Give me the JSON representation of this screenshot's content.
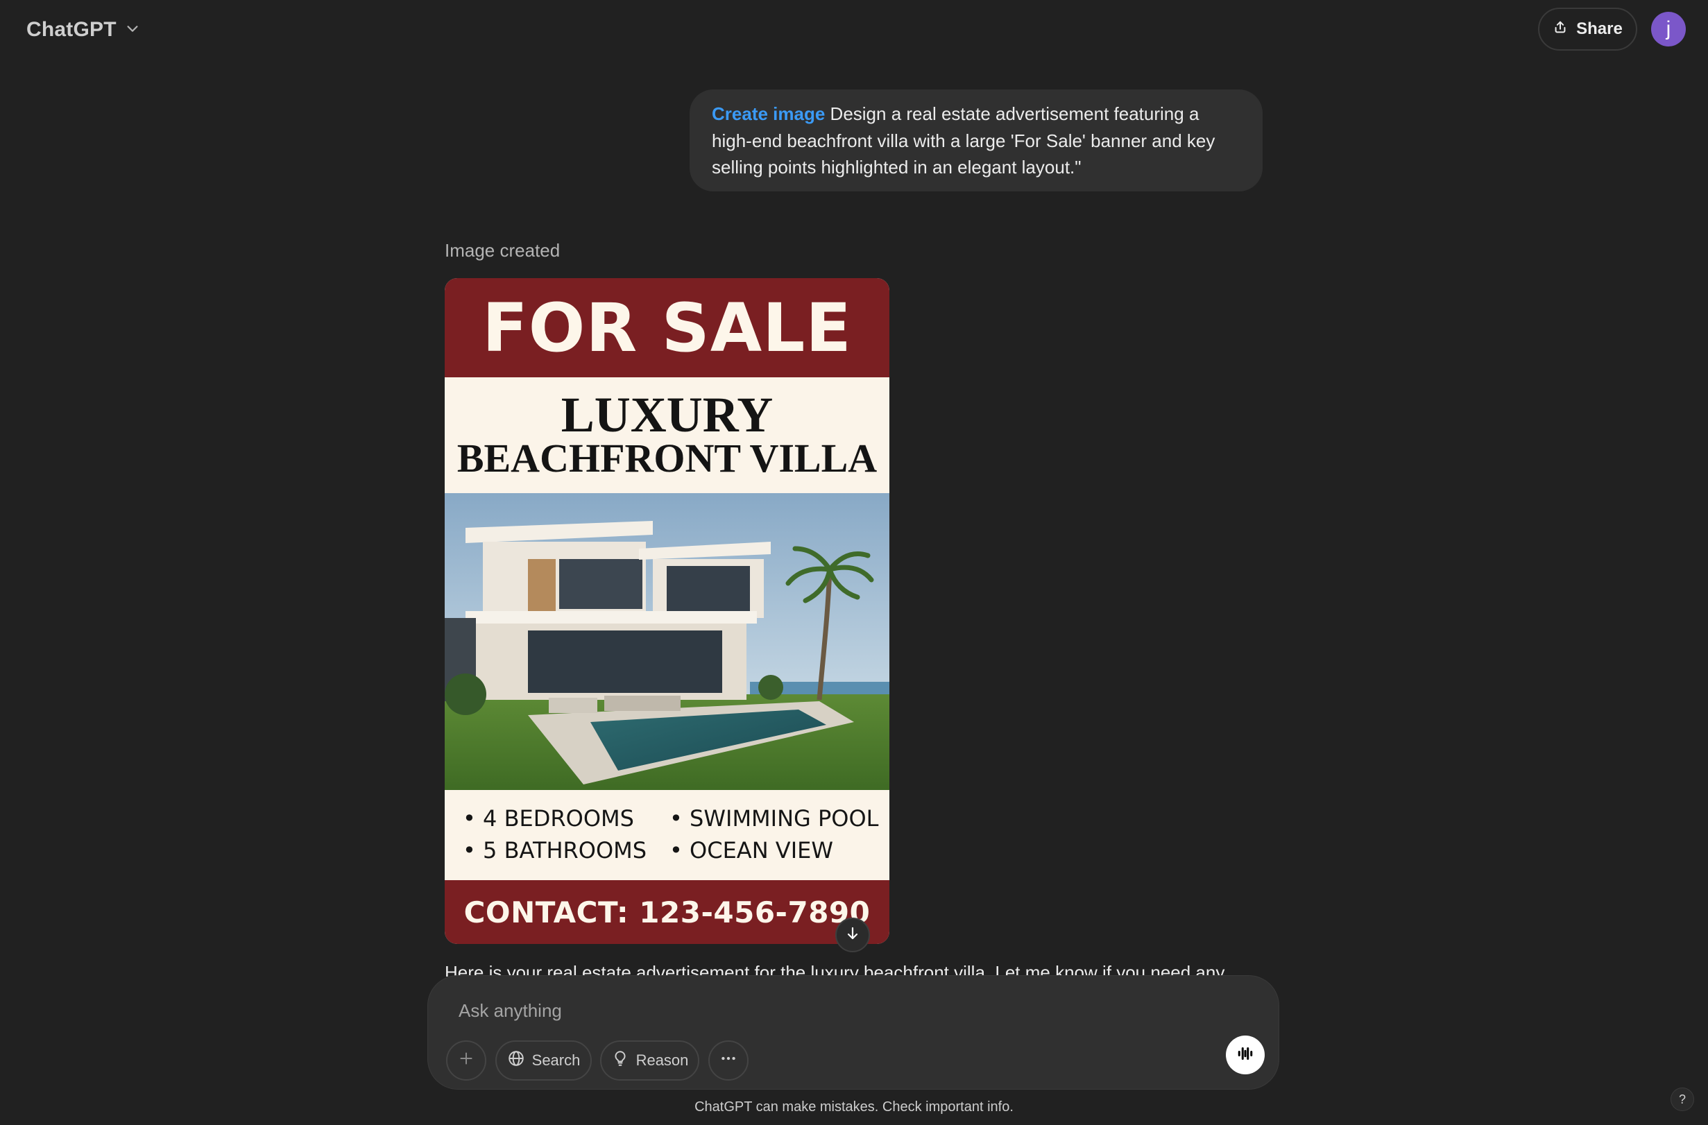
{
  "header": {
    "model_name": "ChatGPT",
    "share_label": "Share",
    "avatar_initial": "j"
  },
  "user_message": {
    "tool_chip": "Create image",
    "text": "Design a real estate advertisement featuring a high-end beachfront villa with a large 'For Sale' banner and key selling points highlighted in an elegant layout.\""
  },
  "assistant": {
    "status": "Image created",
    "reply": "Here is your real estate advertisement for the luxury beachfront villa. Let me know if you need any",
    "ad": {
      "banner": "FOR SALE",
      "title_line1": "LUXURY",
      "title_line2": "BEACHFRONT VILLA",
      "features": [
        "4 BEDROOMS",
        "5 BATHROOMS",
        "SWIMMING POOL",
        "OCEAN VIEW"
      ],
      "contact": "CONTACT: 123-456-7890",
      "banner_color": "#7a1f22",
      "cream_color": "#fbf4e9"
    }
  },
  "composer": {
    "placeholder": "Ask anything",
    "search_label": "Search",
    "reason_label": "Reason"
  },
  "footer": {
    "disclaimer": "ChatGPT can make mistakes. Check important info.",
    "help": "?"
  },
  "icons": [
    "chevron-down-icon",
    "share-icon",
    "arrow-down-icon",
    "plus-icon",
    "globe-icon",
    "lightbulb-icon",
    "more-icon",
    "voice-icon"
  ],
  "colors": {
    "background": "#212121",
    "surface": "#303030",
    "accent_link": "#3b9af5",
    "avatar": "#7b57c9"
  }
}
